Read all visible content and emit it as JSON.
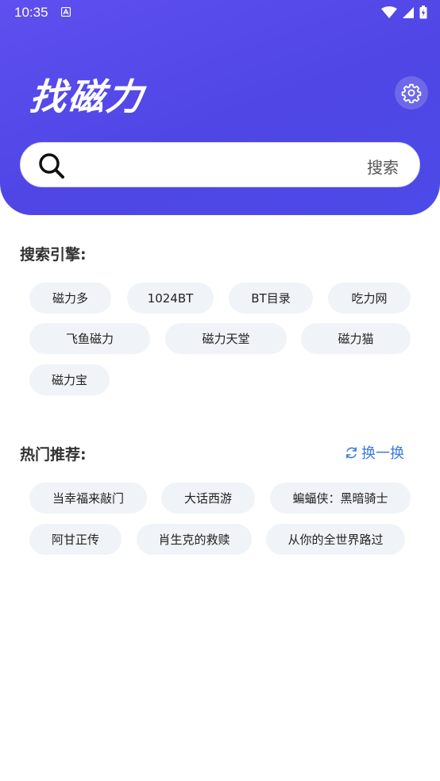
{
  "status": {
    "time": "10:35"
  },
  "header": {
    "title": "找磁力"
  },
  "search": {
    "placeholder": "",
    "value": "",
    "button_label": "搜索"
  },
  "engines": {
    "title": "搜索引擎:",
    "items": [
      "磁力多",
      "1024BT",
      "BT目录",
      "吃力网",
      "飞鱼磁力",
      "磁力天堂",
      "磁力猫",
      "磁力宝"
    ]
  },
  "hot": {
    "title": "热门推荐:",
    "refresh_label": "换一换",
    "items": [
      "当幸福来敲门",
      "大话西游",
      "蝙蝠侠：黑暗骑士",
      "阿甘正传",
      "肖生克的救赎",
      "从你的全世界路过"
    ]
  },
  "colors": {
    "accent": "#4f46e5",
    "link": "#3a7be0",
    "chip_bg": "#f0f3f8"
  }
}
